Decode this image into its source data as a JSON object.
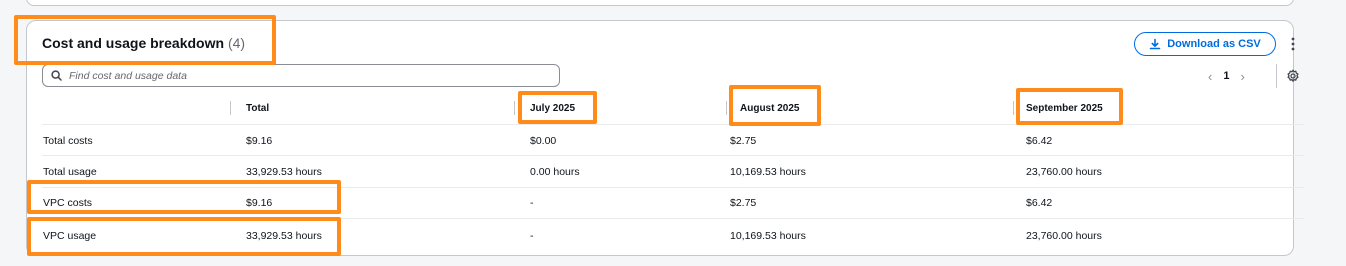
{
  "header": {
    "title": "Cost and usage breakdown",
    "count": "(4)"
  },
  "actions": {
    "download_label": "Download as CSV",
    "more_icon": "more-vertical-icon"
  },
  "search": {
    "placeholder": "Find cost and usage data",
    "value": ""
  },
  "pagination": {
    "current_page": "1",
    "prev_icon": "chevron-left-icon",
    "next_icon": "chevron-right-icon"
  },
  "table": {
    "columns": [
      "",
      "Total",
      "July 2025",
      "August 2025",
      "September 2025"
    ],
    "rows": [
      {
        "label": "Total costs",
        "total": "$9.16",
        "jul": "$0.00",
        "aug": "$2.75",
        "sep": "$6.42"
      },
      {
        "label": "Total usage",
        "total": "33,929.53 hours",
        "jul": "0.00 hours",
        "aug": "10,169.53 hours",
        "sep": "23,760.00 hours"
      },
      {
        "label": "VPC costs",
        "total": "$9.16",
        "jul": "-",
        "aug": "$2.75",
        "sep": "$6.42"
      },
      {
        "label": "VPC usage",
        "total": "33,929.53 hours",
        "jul": "-",
        "aug": "10,169.53 hours",
        "sep": "23,760.00 hours"
      }
    ]
  },
  "colors": {
    "accent": "#006ce0",
    "highlight": "#ff8c1a",
    "border": "#c6c6cd"
  }
}
